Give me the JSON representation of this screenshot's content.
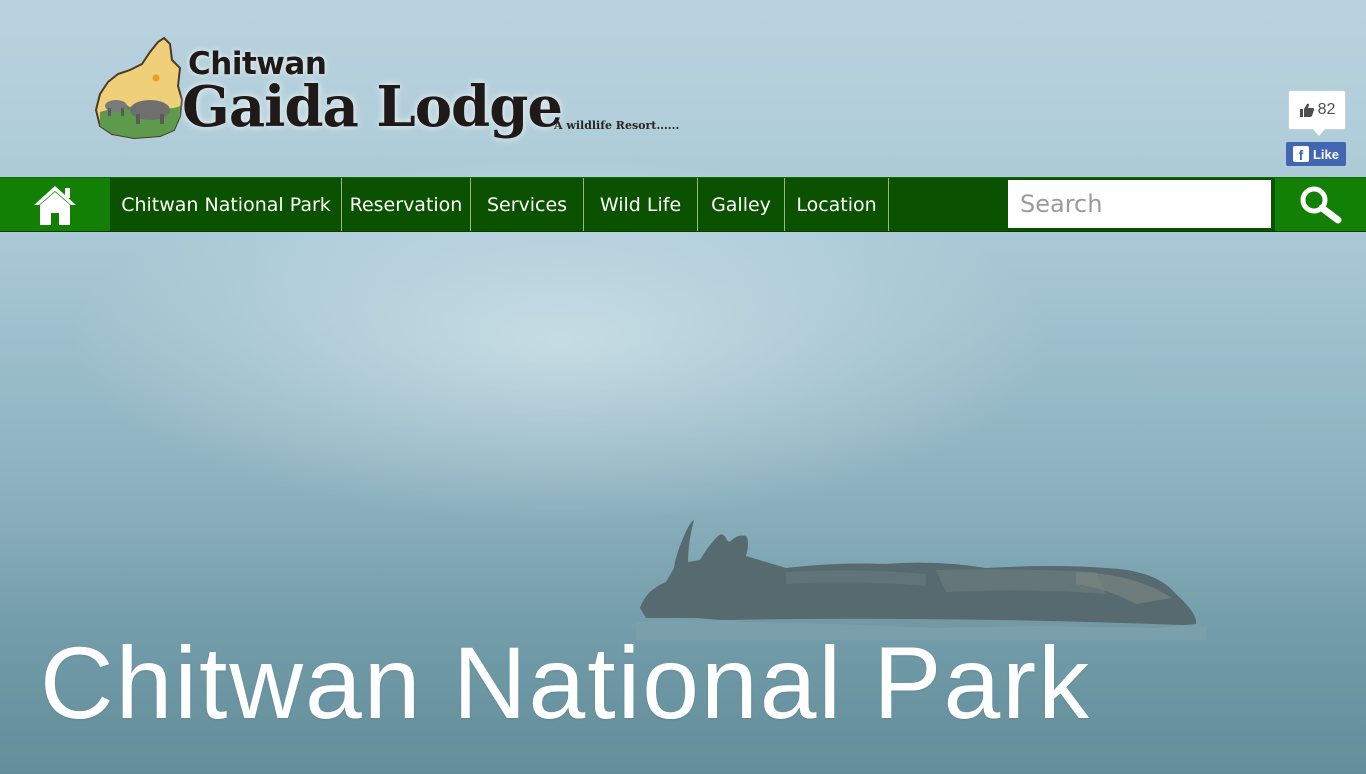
{
  "brand": {
    "name_top": "Chitwan",
    "name_main": "Gaida Lodge",
    "tagline": "A wildlife Resort......",
    "logo_icon": "rhino-map-logo"
  },
  "facebook": {
    "like_count": "82",
    "like_label": "Like",
    "f_letter": "f",
    "icons": [
      "thumbs-up-icon",
      "facebook-icon"
    ]
  },
  "nav": {
    "home_icon": "home-icon",
    "items": [
      {
        "label": "Chitwan National Park"
      },
      {
        "label": "Reservation"
      },
      {
        "label": "Services"
      },
      {
        "label": "Wild Life"
      },
      {
        "label": "Galley"
      },
      {
        "label": "Location"
      }
    ],
    "search_placeholder": "Search",
    "search_icon": "magnifier-icon"
  },
  "hero": {
    "title": "Chitwan National Park",
    "image": "rhino-in-misty-river"
  },
  "colors": {
    "nav_bg": "#0a5200",
    "nav_accent": "#128004",
    "fb_blue": "#4267b2",
    "hero_text": "#ffffff"
  }
}
